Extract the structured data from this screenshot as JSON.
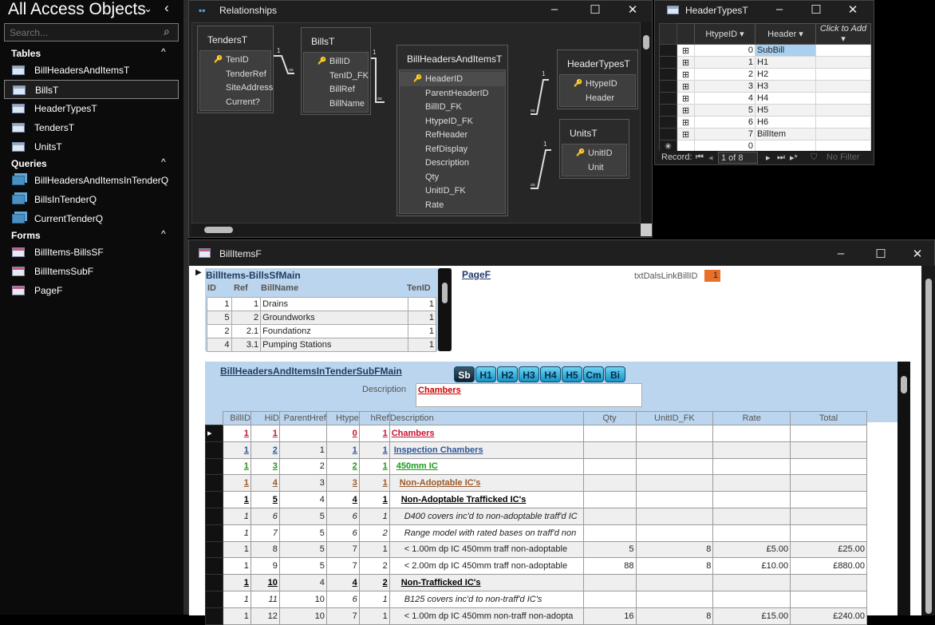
{
  "nav": {
    "title": "All Access Objects",
    "search_placeholder": "Search...",
    "groups": [
      {
        "label": "Tables",
        "items": [
          "BillHeadersAndItemsT",
          "BillsT",
          "HeaderTypesT",
          "TendersT",
          "UnitsT"
        ],
        "selected": "BillsT"
      },
      {
        "label": "Queries",
        "items": [
          "BillHeadersAndItemsInTenderQ",
          "BillsInTenderQ",
          "CurrentTenderQ"
        ]
      },
      {
        "label": "Forms",
        "items": [
          "BillItems-BillsSF",
          "BillItemsSubF",
          "PageF"
        ]
      }
    ]
  },
  "relationships": {
    "title": "Relationships",
    "tables": [
      {
        "name": "TendersT",
        "fields": [
          "TenID",
          "TenderRef",
          "SiteAddress",
          "Current?"
        ]
      },
      {
        "name": "BillsT",
        "fields": [
          "BillID",
          "TenID_FK",
          "BillRef",
          "BillName"
        ]
      },
      {
        "name": "BillHeadersAndItemsT",
        "fields": [
          "HeaderID",
          "ParentHeaderID",
          "BillID_FK",
          "HtypeID_FK",
          "RefHeader",
          "RefDisplay",
          "Description",
          "Qty",
          "UnitID_FK",
          "Rate"
        ]
      },
      {
        "name": "HeaderTypesT",
        "fields": [
          "HtypeID",
          "Header"
        ]
      },
      {
        "name": "UnitsT",
        "fields": [
          "UnitID",
          "Unit"
        ]
      }
    ],
    "one": "1",
    "many": "∞"
  },
  "headertypes": {
    "title": "HeaderTypesT",
    "columns": [
      "HtypeID",
      "Header",
      "Click to Add"
    ],
    "rows": [
      [
        "0",
        "SubBill"
      ],
      [
        "1",
        "H1"
      ],
      [
        "2",
        "H2"
      ],
      [
        "3",
        "H3"
      ],
      [
        "4",
        "H4"
      ],
      [
        "5",
        "H5"
      ],
      [
        "6",
        "H6"
      ],
      [
        "7",
        "BillItem"
      ]
    ],
    "new_row_default": "0",
    "record_label": "Record:",
    "record_pos": "1 of 8",
    "filter_label": "No Filter"
  },
  "form": {
    "title": "BillItemsF",
    "subform1": {
      "title": "BillItems-BillsSfMain",
      "columns": [
        "ID",
        "Ref",
        "BillName",
        "TenID"
      ],
      "rows": [
        [
          "1",
          "1",
          "Drains",
          "1"
        ],
        [
          "5",
          "2",
          "Groundworks",
          "1"
        ],
        [
          "2",
          "2.1",
          "Foundationz",
          "1"
        ],
        [
          "4",
          "3.1",
          "Pumping Stations",
          "1"
        ]
      ]
    },
    "pagef_link": "PageF",
    "link_label": "txtDalsLinkBillID",
    "link_value": "1",
    "subform2": {
      "title": "BillHeadersAndItemsInTenderSubFMain",
      "buttons": [
        "Sb",
        "H1",
        "H2",
        "H3",
        "H4",
        "H5",
        "Cm",
        "Bi"
      ],
      "active_button": "Sb",
      "description_label": "Description",
      "description_value": "Chambers",
      "columns": [
        "BillID",
        "HiD",
        "ParentHref",
        "Htype",
        "hRef",
        "Description",
        "Qty",
        "UnitID_FK",
        "Rate",
        "Total"
      ],
      "rows": [
        [
          "1",
          "1",
          "",
          "0",
          "1",
          "Chambers",
          "",
          "",
          "",
          ""
        ],
        [
          "1",
          "2",
          "1",
          "1",
          "1",
          "Inspection Chambers",
          "",
          "",
          "",
          ""
        ],
        [
          "1",
          "3",
          "2",
          "2",
          "1",
          "450mm IC",
          "",
          "",
          "",
          ""
        ],
        [
          "1",
          "4",
          "3",
          "3",
          "1",
          "Non-Adoptable IC's",
          "",
          "",
          "",
          ""
        ],
        [
          "1",
          "5",
          "4",
          "4",
          "1",
          "Non-Adoptable Trafficked IC's",
          "",
          "",
          "",
          ""
        ],
        [
          "1",
          "6",
          "5",
          "6",
          "1",
          "D400 covers inc'd to non-adoptable traff'd IC",
          "",
          "",
          "",
          ""
        ],
        [
          "1",
          "7",
          "5",
          "6",
          "2",
          "Range model with rated bases on traff'd non",
          "",
          "",
          "",
          ""
        ],
        [
          "1",
          "8",
          "5",
          "7",
          "1",
          "< 1.00m dp IC 450mm traff non-adoptable",
          "5",
          "8",
          "£5.00",
          "£25.00"
        ],
        [
          "1",
          "9",
          "5",
          "7",
          "2",
          "< 2.00m dp IC 450mm traff non-adoptable",
          "88",
          "8",
          "£10.00",
          "£880.00"
        ],
        [
          "1",
          "10",
          "4",
          "4",
          "2",
          "Non-Trafficked IC's",
          "",
          "",
          "",
          ""
        ],
        [
          "1",
          "11",
          "10",
          "6",
          "1",
          "B125 covers inc'd to non-traff'd IC's",
          "",
          "",
          "",
          ""
        ],
        [
          "1",
          "12",
          "10",
          "7",
          "1",
          "< 1.00m dp IC 450mm non-traff non-adopta",
          "16",
          "8",
          "£15.00",
          "£240.00"
        ]
      ]
    },
    "htype_colors": {
      "0": "#c8102e",
      "1": "#2e5597",
      "2": "#1a9a1a",
      "3": "#9a5a2a",
      "4": "#000000"
    }
  },
  "colors": {
    "accent_orange": "#e8702a",
    "subform_bg": "#bcd5ee"
  }
}
